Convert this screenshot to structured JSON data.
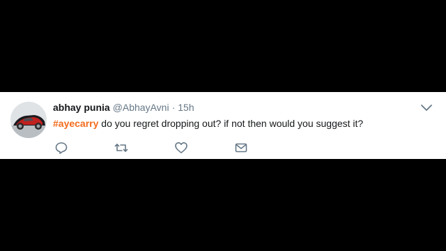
{
  "tweet": {
    "display_name": "abhay punia",
    "handle": "@AbhayAvni",
    "separator": "·",
    "time": "15h",
    "hashtag": "#ayecarry",
    "body": " do you regret dropping out? if not then would you suggest it?"
  },
  "icons": {
    "menu": "chevron-down-icon",
    "reply": "reply-icon",
    "retweet": "retweet-icon",
    "like": "heart-icon",
    "message": "envelope-icon"
  },
  "colors": {
    "hashtag": "#f26b1d",
    "name": "#14171a",
    "meta": "#657786",
    "background": "#000000",
    "card": "#ffffff"
  }
}
